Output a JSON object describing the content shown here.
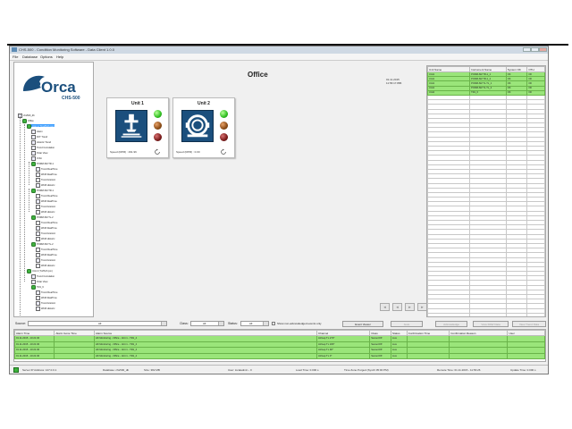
{
  "window": {
    "title": "CHS-500 - Condition Monitoring Software - Data Client 1.0.0",
    "menu": [
      "File",
      "Database",
      "Options",
      "Help"
    ]
  },
  "logo": {
    "brand": "Orca",
    "model": "CHS-500"
  },
  "tree": [
    "chs500_db",
    "Office",
    "Unit 1 (TC-MS,8 rpm)",
    "Alarm",
    "FFT Trend",
    "Historic Trend",
    "Trend Correlation",
    "Polar View",
    "Orbit",
    "PORM-SM TR-1",
    "Trend RealTime",
    "Wrdif RealTime",
    "Trend Historic",
    "Wrdif Historic",
    "PORM-SM TR-1",
    "Trend RealTime",
    "Wrdif RealTime",
    "Trend Historic",
    "Wrdif Historic",
    "PORM-SM TL-2",
    "Trend RealTime",
    "Wrdif RealTime",
    "Trend Historic",
    "Wrdif Historic",
    "PORM-SM TL-2",
    "Trend RealTime",
    "Wrdif RealTime",
    "Trend Historic",
    "Wrdif Historic",
    "Unit 2 (T-MS,8 rpm)",
    "Trend Correlation",
    "Polar View",
    "TR1_6",
    "Trend RealTime",
    "Wrdif RealTime",
    "Trend Historic",
    "Wrdif Historic"
  ],
  "main": {
    "title": "Office",
    "date": "01.11.2015",
    "time": "11:56:17.886",
    "units": [
      {
        "name": "Unit 1",
        "speed": "Speed (RPM) : 291.96",
        "icon": "pump-icon"
      },
      {
        "name": "Unit 2",
        "speed": "Speed (RPM) : 0.00",
        "icon": "motor-icon"
      }
    ],
    "nav": [
      "◄",
      "◄",
      "►",
      "►"
    ]
  },
  "instruments": {
    "headers": [
      "Unit Name",
      "Instrument Name",
      "System OK",
      "OTH"
    ],
    "rows": [
      [
        "Unit1",
        "PORM-SM TR-1_1",
        "OK",
        "OK"
      ],
      [
        "Unit1",
        "PORM-SM TR-1_2",
        "OK",
        "OK"
      ],
      [
        "Unit1",
        "PORM-SM TL-TL_1",
        "OK",
        "OK"
      ],
      [
        "Unit1",
        "PORM-SM TL-TL_2",
        "OK",
        "OK"
      ],
      [
        "Unit2",
        "TR1_6",
        "OK",
        "OK"
      ]
    ]
  },
  "filters": {
    "source_label": "Source:",
    "source_value": "All",
    "class_label": "Class:",
    "class_value": "All",
    "status_label": "Status:",
    "status_value": "All",
    "nonack_label": "Show non-acknowledged events only",
    "buttons": [
      "Event Viewer",
      "Goto",
      "Acknowledge",
      "View RAW Data",
      "View Trend Data"
    ]
  },
  "alarms": {
    "headers": [
      "Alarm Time",
      "Alarm Gone Time",
      "Alarm Source",
      "Channel",
      "Class",
      "Status",
      "Confirmation Time",
      "Confirmation Reason",
      "User"
    ],
    "rows": [
      [
        "01.11.2015 - 10:21:30",
        "",
        "HK Monitoring - Office - Unit 1 - TR1_4",
        "AirGap TL 270°",
        "SensorOff",
        "Live",
        "",
        "",
        ""
      ],
      [
        "01.11.2015 - 10:21:30",
        "",
        "HK Monitoring - Office - Unit 1 - TR1_4",
        "AirGap TL 180°",
        "SensorOff",
        "Live",
        "",
        "",
        ""
      ],
      [
        "01.11.2015 - 10:21:30",
        "",
        "HK Monitoring - Office - Unit 1 - TR1_4",
        "AirGap TL 90°",
        "SensorOff",
        "Live",
        "",
        "",
        ""
      ],
      [
        "01.11.2015 - 10:21:30",
        "",
        "HK Monitoring - Office - Unit 1 - TR1_4",
        "AirGap TL 0°",
        "SensorOff",
        "Live",
        "",
        "",
        ""
      ]
    ]
  },
  "status": {
    "server": "Server IP Address: 127.0.0.1",
    "database": "Database: chs500_db",
    "size": "Size: 382 MB",
    "user": "User: localadmin - 0",
    "load": "Load Time: 0.000 s",
    "purge": "Time Zone Purged (Synch 05:00 PM)",
    "remote": "Remote Time: 01.11.2015 - 11:56:26",
    "update": "Update Time: 0.000 s"
  },
  "colors": {
    "ok_green": "#9ae57a",
    "unit_blue": "#1b4f7d",
    "led_green": "#2fbf20"
  }
}
